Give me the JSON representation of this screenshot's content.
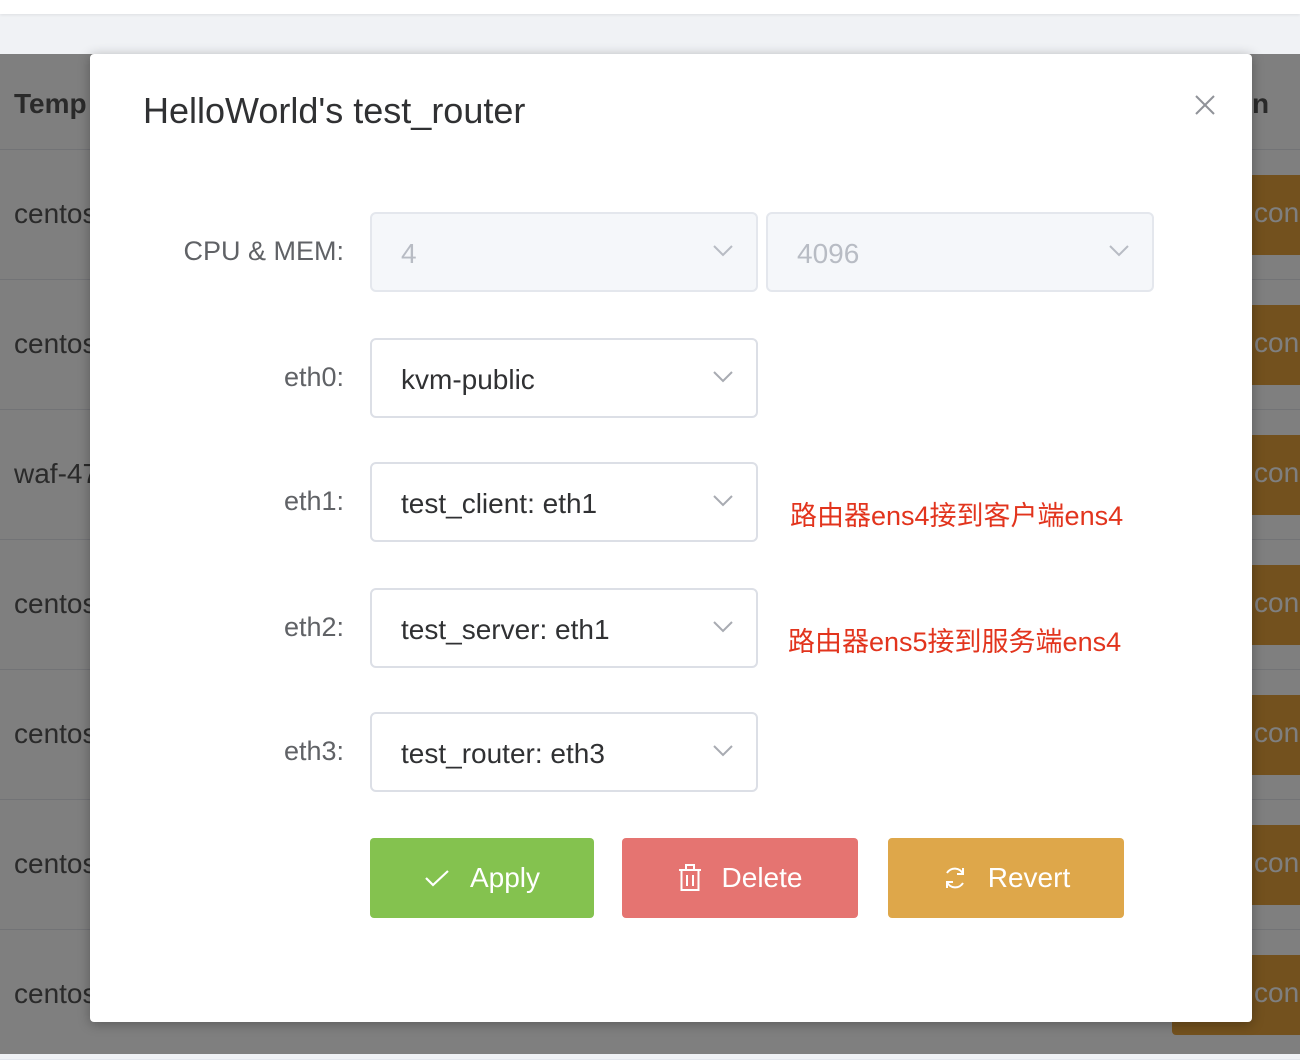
{
  "background": {
    "table_header_left": "Temp",
    "table_header_right": "n",
    "rows": [
      {
        "name": "centos",
        "action": "cons"
      },
      {
        "name": "centos",
        "action": "cons"
      },
      {
        "name": "waf-47",
        "action": "cons"
      },
      {
        "name": "centos",
        "action": "cons"
      },
      {
        "name": "centos",
        "action": "cons"
      },
      {
        "name": "centos",
        "action": "cons"
      },
      {
        "name": "centos",
        "action": "cons"
      }
    ]
  },
  "dialog": {
    "title": "HelloWorld's test_router",
    "close_icon": "close-icon",
    "fields": {
      "cpu_mem_label": "CPU & MEM:",
      "cpu_value": "4",
      "mem_value": "4096",
      "eth0_label": "eth0:",
      "eth0_value": "kvm-public",
      "eth1_label": "eth1:",
      "eth1_value": "test_client: eth1",
      "eth1_note": "路由器ens4接到客户端ens4",
      "eth2_label": "eth2:",
      "eth2_value": "test_server: eth1",
      "eth2_note": "路由器ens5接到服务端ens4",
      "eth3_label": "eth3:",
      "eth3_value": "test_router: eth3"
    },
    "buttons": {
      "apply_label": "Apply",
      "delete_label": "Delete",
      "revert_label": "Revert"
    }
  },
  "colors": {
    "apply": "#84c24f",
    "delete": "#e57471",
    "revert": "#dea74a",
    "note": "#e2341d",
    "console_button": "#e6a23c"
  }
}
